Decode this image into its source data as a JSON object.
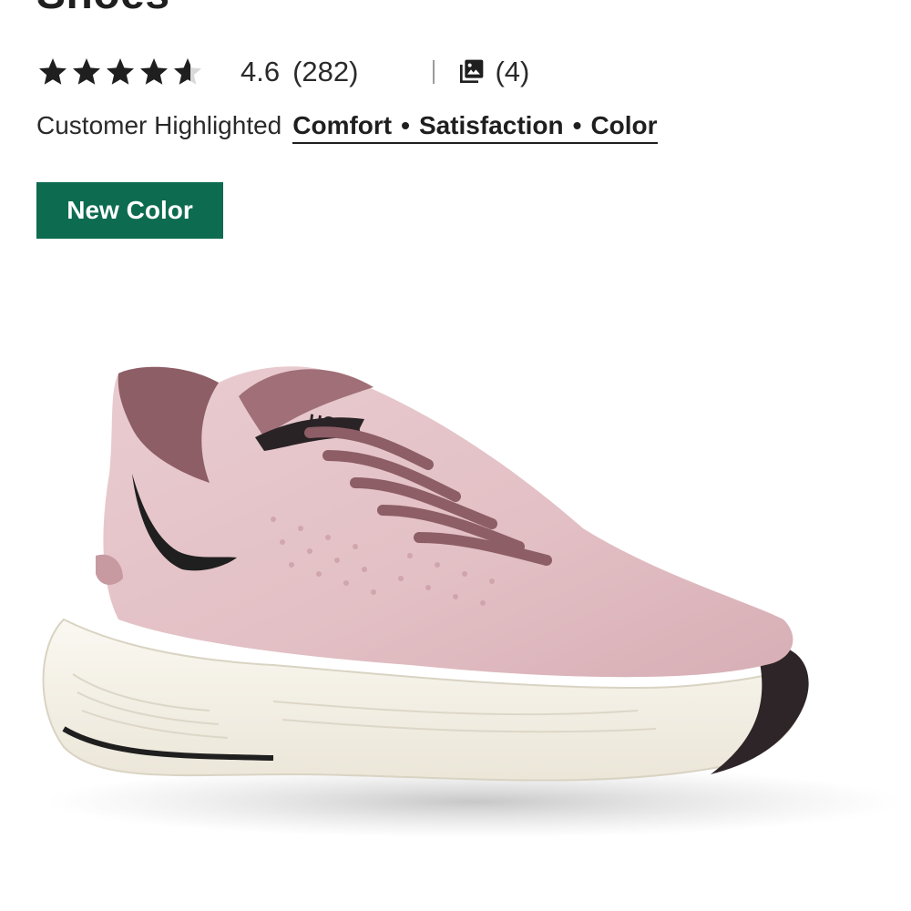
{
  "product": {
    "title_fragment": "Shoes"
  },
  "rating": {
    "value": "4.6",
    "count": "(282)",
    "stars_filled_fraction": 0.92,
    "star_color": "#1f1f1f"
  },
  "photos": {
    "count": "(4)",
    "icon": "photo-gallery-icon"
  },
  "highlights": {
    "label": "Customer Highlighted",
    "items": [
      "Comfort",
      "Satisfaction",
      "Color"
    ],
    "separator": "•"
  },
  "badge": {
    "label": "New Color",
    "color": "#0d6b50"
  },
  "image": {
    "brand_mark": "HOKA",
    "upper_color": "#e8c9ce",
    "accent_color": "#8d5e66",
    "sole_color": "#f3efe4"
  }
}
